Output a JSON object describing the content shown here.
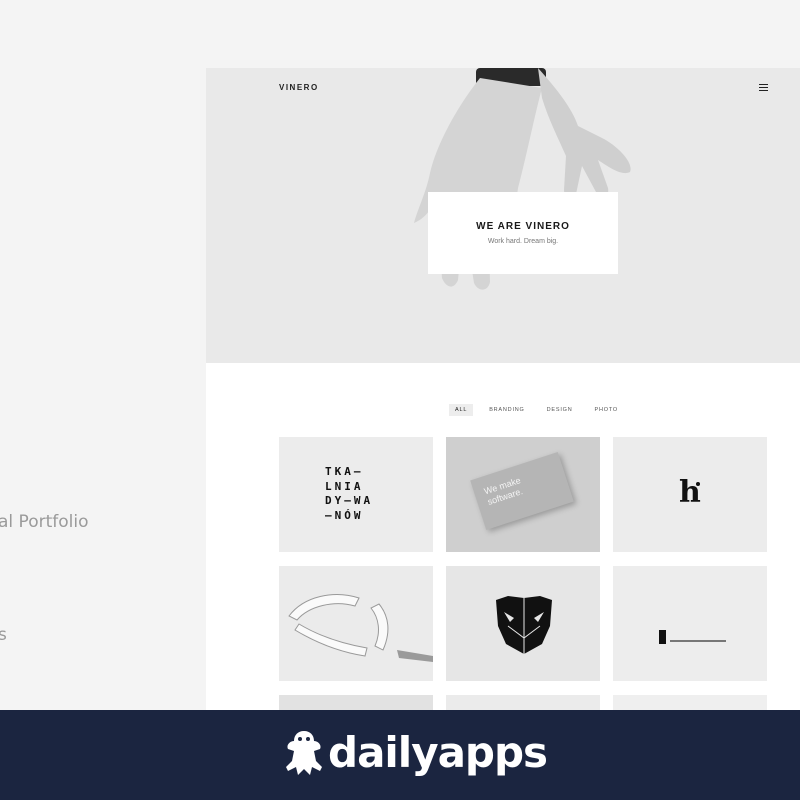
{
  "left_panel": {
    "line1": "al Portfolio",
    "line2": "s"
  },
  "preview": {
    "brand": "VINERO",
    "menu_icon": "hamburger-icon",
    "hero": {
      "title": "WE ARE VINERO",
      "subtitle": "Work hard. Dream big."
    },
    "filters": [
      "ALL",
      "BRANDING",
      "DESIGN",
      "PHOTO"
    ],
    "active_filter": "ALL",
    "tiles": {
      "tkalnia_lines": [
        "TKA–",
        "LNIA",
        "DY–WA",
        "–NÓW"
      ],
      "card_lines": [
        "We make",
        "software."
      ],
      "logo_letter": "h"
    }
  },
  "footer": {
    "brand": "dailyapps",
    "logo_icon": "frog-icon",
    "background": "#1b2540"
  }
}
